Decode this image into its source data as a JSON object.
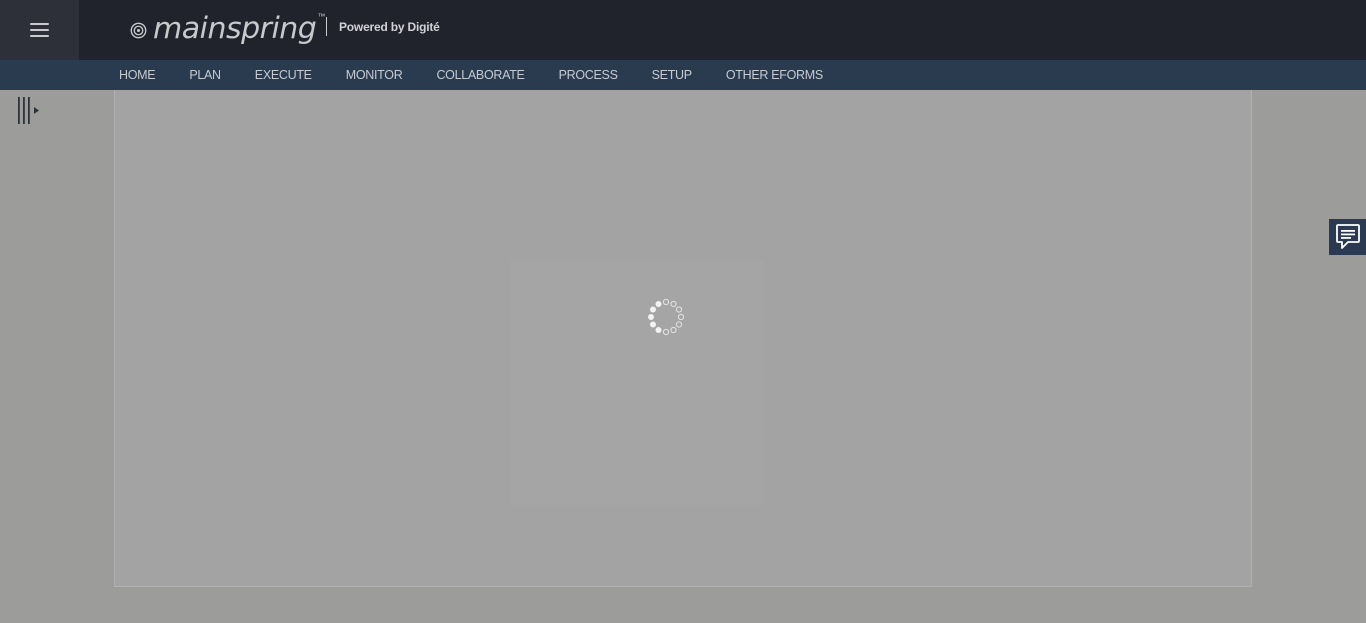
{
  "header": {
    "logo_text": "mainspring",
    "logo_tm": "™",
    "powered_by": "Powered by Digité"
  },
  "nav": {
    "items": [
      {
        "label": "HOME"
      },
      {
        "label": "PLAN"
      },
      {
        "label": "EXECUTE"
      },
      {
        "label": "MONITOR"
      },
      {
        "label": "COLLABORATE"
      },
      {
        "label": "PROCESS"
      },
      {
        "label": "SETUP"
      },
      {
        "label": "OTHER EFORMS"
      }
    ]
  },
  "icons": {
    "menu": "hamburger-menu-icon",
    "logo": "mainspring-spiral-logo",
    "panel_toggle": "expand-panel-icon",
    "loading": "loading-spinner-icon",
    "feedback": "chat-feedback-icon"
  },
  "colors": {
    "header_bg": "#20232c",
    "nav_bg": "#2a3a4f",
    "overlay_bg": "#9c9d9b",
    "content_bg": "#a3a3a3"
  }
}
